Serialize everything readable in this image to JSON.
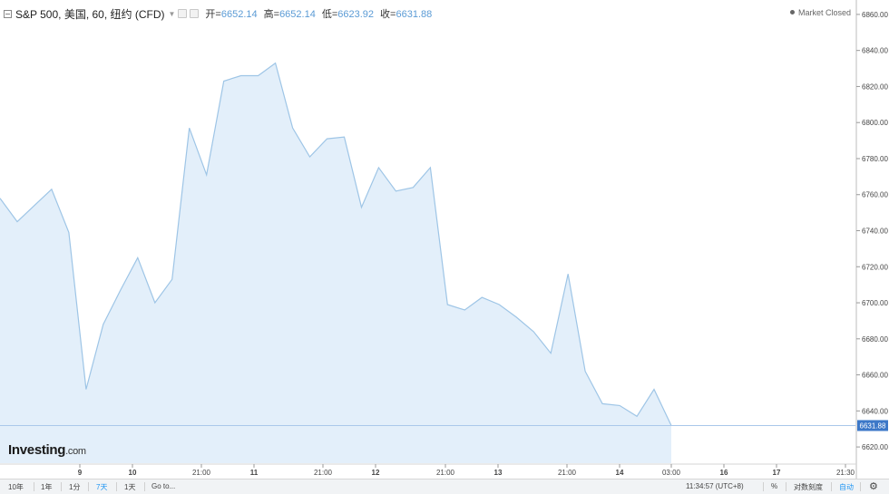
{
  "header": {
    "title": "S&P 500, 美国, 60, 纽约 (CFD)",
    "open_label": "开=",
    "open_value": "6652.14",
    "high_label": "高=",
    "high_value": "6652.14",
    "low_label": "低=",
    "low_value": "6623.92",
    "close_label": "收=",
    "close_value": "6631.88"
  },
  "market_status": "Market Closed",
  "logo": {
    "main": "Investing",
    "domain": ".com"
  },
  "bottom_bar": {
    "ranges": [
      "10年",
      "1年",
      "1分",
      "7天",
      "1天"
    ],
    "active_range": "7天",
    "goto": "Go to...",
    "time": "11:34:57 (UTC+8)",
    "percent": "%",
    "log": "对数刻度",
    "auto": "自动"
  },
  "colors": {
    "line": "#9ec5e6",
    "fill": "#e3effa",
    "price_tag": "#3c78c8",
    "accent": "#2196f3"
  },
  "chart_data": {
    "type": "area",
    "y_ticks": [
      6620,
      6640,
      6660,
      6680,
      6700,
      6720,
      6740,
      6760,
      6780,
      6800,
      6820,
      6840,
      6860
    ],
    "y_tick_labels": [
      "6620.00",
      "6640.00",
      "6660.00",
      "6680.00",
      "6700.00",
      "6720.00",
      "6740.00",
      "6760.00",
      "6780.00",
      "6800.00",
      "6820.00",
      "6840.00",
      "6860.00"
    ],
    "ylim": [
      6611,
      6868
    ],
    "x_ticks": [
      "9",
      "10",
      "21:00",
      "11",
      "21:00",
      "12",
      "21:00",
      "13",
      "21:00",
      "14",
      "03:00",
      "16",
      "17",
      "21:30"
    ],
    "last_value": 6631.88,
    "last_value_label": "6631.88",
    "values": [
      6758,
      6745,
      6754,
      6763,
      6739,
      6652,
      6688,
      6707,
      6725,
      6700,
      6713,
      6797,
      6771,
      6823,
      6826,
      6826,
      6833,
      6797,
      6781,
      6791,
      6792,
      6753,
      6775,
      6762,
      6764,
      6775,
      6699,
      6696,
      6703,
      6699,
      6692,
      6684,
      6672,
      6716,
      6662,
      6644,
      6643,
      6637,
      6652,
      6631.88
    ]
  }
}
